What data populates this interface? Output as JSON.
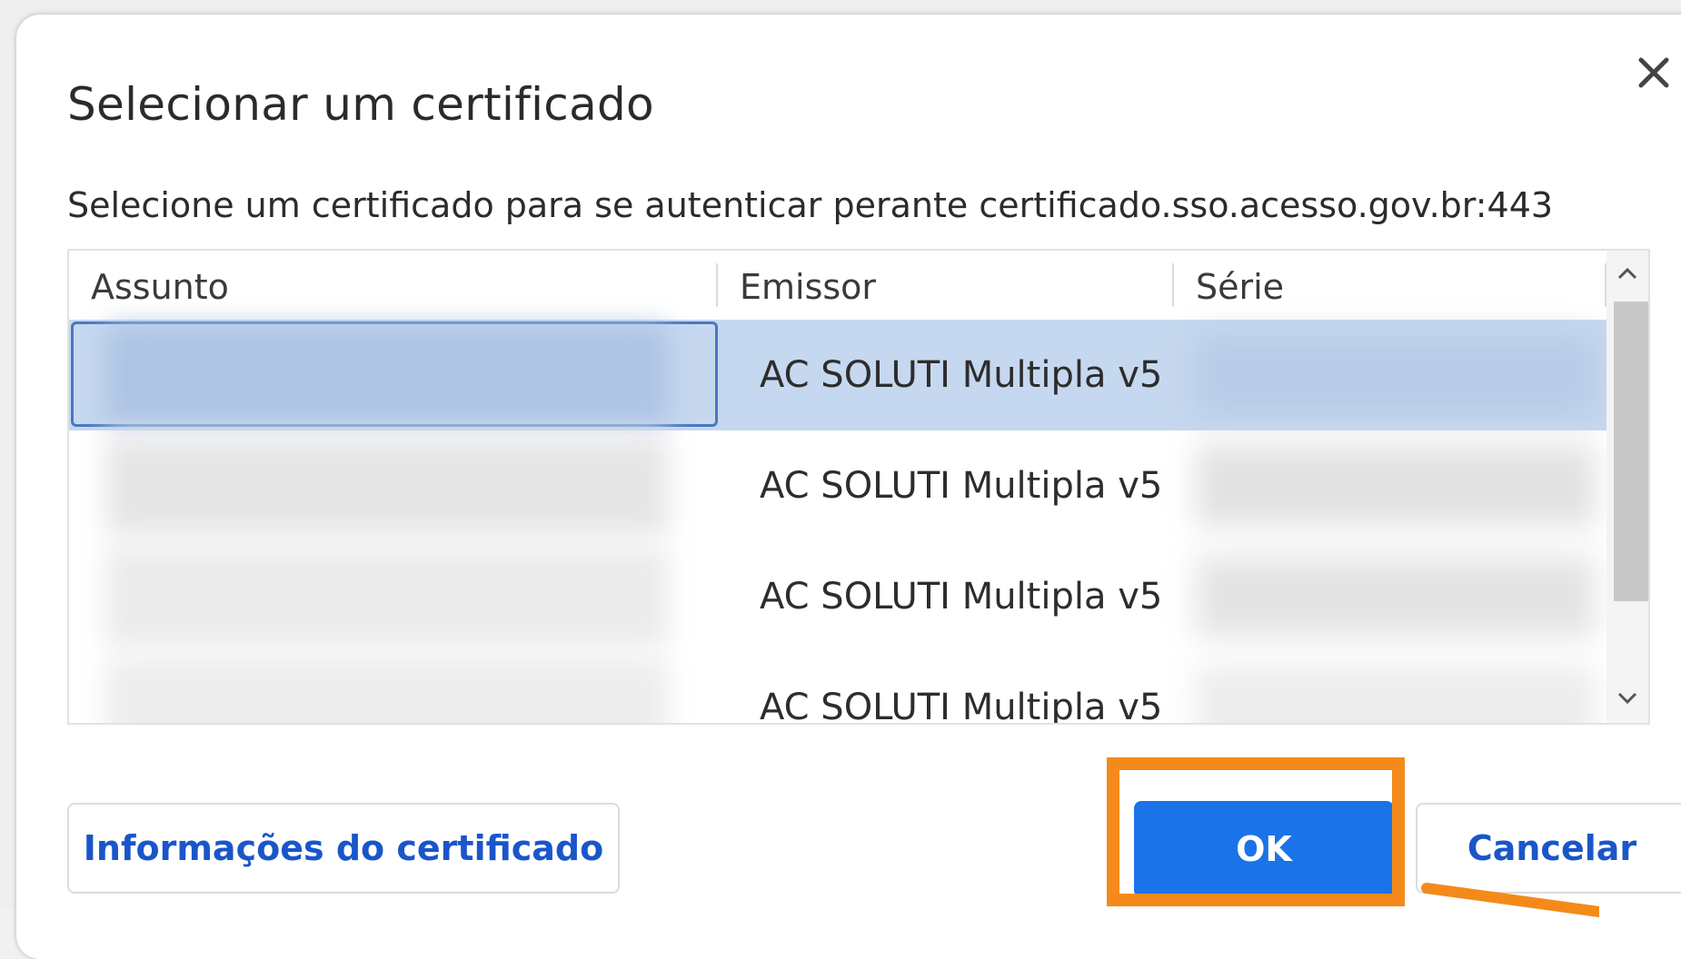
{
  "dialog": {
    "title": "Selecionar um certificado",
    "subtitle": "Selecione um certificado para se autenticar perante certificado.sso.acesso.gov.br:443"
  },
  "table": {
    "columns": [
      "Assunto",
      "Emissor",
      "Série"
    ],
    "rows": [
      {
        "subject": "",
        "issuer": "AC SOLUTI Multipla v5",
        "serial": "",
        "selected": true
      },
      {
        "subject": "",
        "issuer": "AC SOLUTI Multipla v5",
        "serial": "",
        "selected": false
      },
      {
        "subject": "",
        "issuer": "AC SOLUTI Multipla v5",
        "serial": "",
        "selected": false
      },
      {
        "subject": "",
        "issuer": "AC SOLUTI Multipla v5",
        "serial": "",
        "selected": false
      }
    ]
  },
  "buttons": {
    "info_label": "Informações do certificado",
    "ok_label": "OK",
    "cancel_label": "Cancelar"
  },
  "icons": {
    "close": "close-icon",
    "scroll_up": "chevron-up-icon",
    "scroll_down": "chevron-down-icon"
  },
  "colors": {
    "accent": "#1a73e8",
    "selection": "#c6d8ef",
    "highlight": "#f48a1a",
    "link_text": "#1a56c9"
  }
}
